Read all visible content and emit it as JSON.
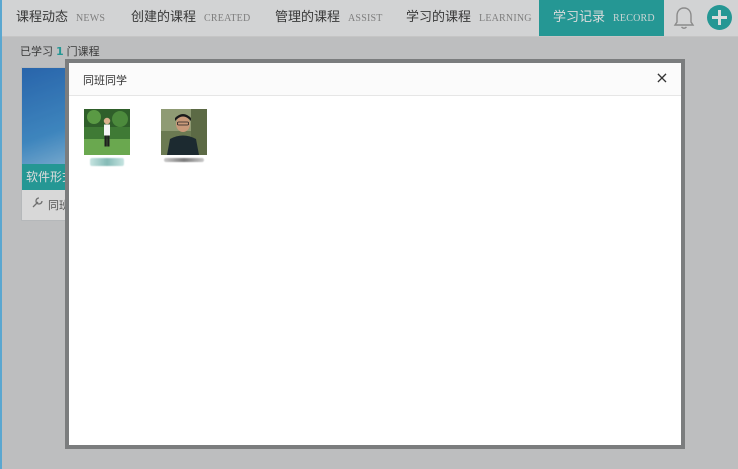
{
  "nav": {
    "items": [
      {
        "label": "课程动态",
        "en": "NEWS"
      },
      {
        "label": "创建的课程",
        "en": "CREATED"
      },
      {
        "label": "管理的课程",
        "en": "ASSIST"
      },
      {
        "label": "学习的课程",
        "en": "LEARNING"
      },
      {
        "label": "学习记录",
        "en": "RECORD"
      }
    ],
    "active_index": 4,
    "icons": [
      "bell-icon",
      "plus-circle-icon"
    ],
    "accent_color": "#1ba9a6"
  },
  "summary": {
    "prefix": "已学习",
    "count": "1",
    "suffix": "门课程"
  },
  "course_card": {
    "title": "软件形式",
    "footer_label": "同班",
    "footer_icon": "wrench-icon"
  },
  "modal": {
    "title": "同班同学",
    "close_label": "×",
    "classmates": [
      {
        "avatar": "photo-person-outdoor"
      },
      {
        "avatar": "photo-person-portrait"
      }
    ]
  }
}
